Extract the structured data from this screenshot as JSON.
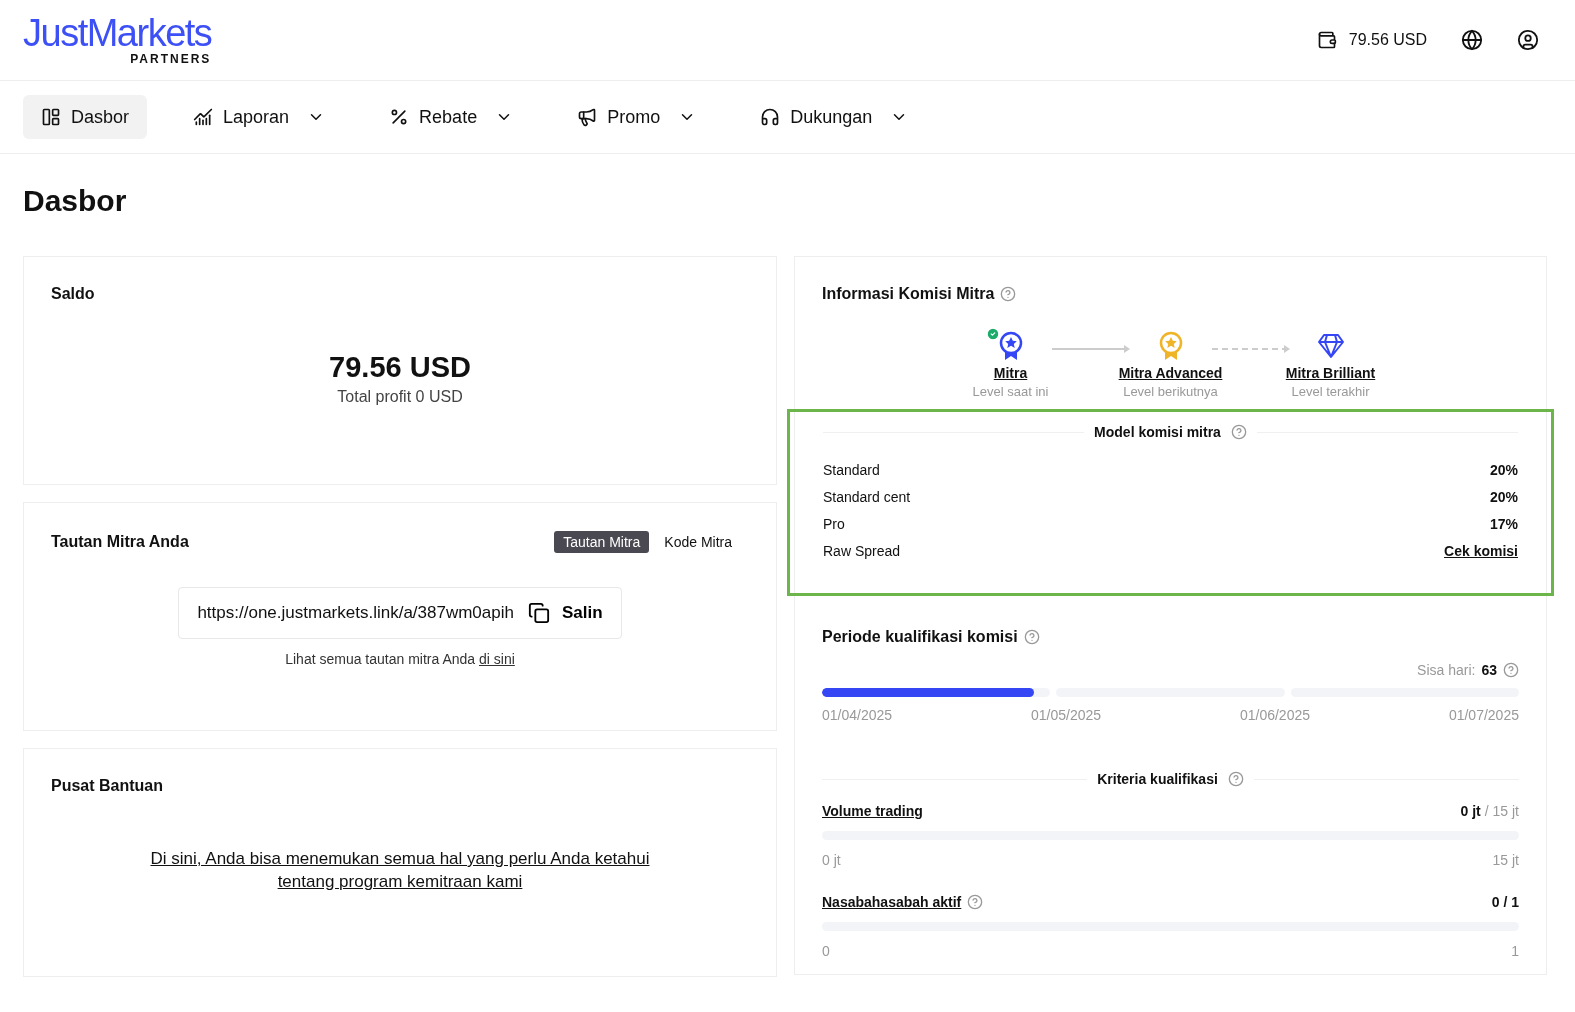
{
  "header": {
    "logo": "JustMarkets",
    "logo_sub": "PARTNERS",
    "balance": "79.56 USD"
  },
  "nav": [
    {
      "label": "Dasbor",
      "selected": true,
      "menu": false
    },
    {
      "label": "Laporan",
      "selected": false,
      "menu": true
    },
    {
      "label": "Rebate",
      "selected": false,
      "menu": true
    },
    {
      "label": "Promo",
      "selected": false,
      "menu": true
    },
    {
      "label": "Dukungan",
      "selected": false,
      "menu": true
    }
  ],
  "page_title": "Dasbor",
  "saldo": {
    "title": "Saldo",
    "amount": "79.56 USD",
    "profit": "Total profit 0 USD"
  },
  "link_card": {
    "title": "Tautan Mitra Anda",
    "tabs": [
      {
        "label": "Tautan Mitra",
        "selected": true
      },
      {
        "label": "Kode Mitra",
        "selected": false
      }
    ],
    "url": "https://one.justmarkets.link/a/387wm0apih",
    "copy": "Salin",
    "note": "Lihat semua tautan mitra Anda",
    "note_link": "di sini"
  },
  "help": {
    "title": "Pusat Bantuan",
    "link": "Di sini, Anda bisa menemukan semua hal yang perlu Anda ketahui tentang program kemitraan kami"
  },
  "commission": {
    "title": "Informasi Komisi Mitra",
    "levels": [
      {
        "kind": "ribbon",
        "name": "Mitra",
        "caption": "Level saat ini",
        "done": true
      },
      {
        "kind": "medal",
        "name": "Mitra Advanced",
        "caption": "Level berikutnya",
        "done": false
      },
      {
        "kind": "diamond",
        "name": "Mitra Brilliant",
        "caption": "Level terakhir",
        "done": false
      }
    ],
    "model": {
      "title": "Model komisi mitra",
      "highlighted": true,
      "rows": [
        {
          "label": "Standard",
          "value": "20%",
          "kind": "text"
        },
        {
          "label": "Standard cent",
          "value": "20%",
          "kind": "text"
        },
        {
          "label": "Pro",
          "value": "17%",
          "kind": "text"
        },
        {
          "label": "Raw Spread",
          "value": "Cek komisi",
          "kind": "link"
        }
      ]
    }
  },
  "period": {
    "title": "Periode kualifikasi komisi",
    "remaining_label": "Sisa hari:",
    "remaining": "63",
    "segments": [
      {
        "level": 0.93
      },
      {
        "level": 0
      },
      {
        "level": 0
      }
    ],
    "dates": [
      "01/04/2025",
      "01/05/2025",
      "01/06/2025",
      "01/07/2025"
    ],
    "criteria_title": "Kriteria kualifikasi",
    "criteria": [
      {
        "label": "Volume trading",
        "help": false,
        "current": "0 jt",
        "target": "/ 15 jt",
        "target_muted": true,
        "level": 0,
        "min": "0 jt",
        "max": "15 jt"
      },
      {
        "label": "Nasabahasabah aktif",
        "help": true,
        "current": "0",
        "target": "/ 1",
        "target_muted": false,
        "level": 0,
        "min": "0",
        "max": "1"
      }
    ]
  }
}
